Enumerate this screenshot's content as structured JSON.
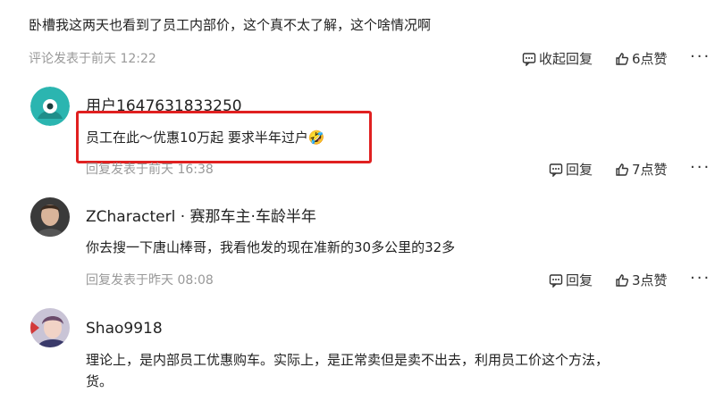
{
  "top_comment": {
    "text": "卧槽我这两天也看到了员工内部价，这个真不太了解，这个啥情况啊",
    "meta": "评论发表于前天 12:22",
    "collapse_label": "收起回复",
    "like_label": "6点赞",
    "more_label": "···"
  },
  "replies": [
    {
      "username": "用户1647631833250",
      "text": "员工在此～优惠10万起 要求半年过户🤣",
      "meta": "回复发表于前天 16:38",
      "reply_label": "回复",
      "like_label": "7点赞",
      "more_label": "···"
    },
    {
      "username": "ZCharacterl · 赛那车主·车龄半年",
      "text": "你去搜一下唐山棒哥，我看他发的现在准新的30多公里的32多",
      "meta": "回复发表于昨天 08:08",
      "reply_label": "回复",
      "like_label": "3点赞",
      "more_label": "···"
    },
    {
      "username": "Shao9918",
      "text": "理论上，是内部员工优惠购车。实际上，是正常卖但是卖不出去，利用员工价这个方法，",
      "text_line2": "货。"
    }
  ],
  "colors": {
    "highlight": "#e02020",
    "meta_text": "#999999",
    "avatar_teal": "#2bb5b0"
  },
  "icons": [
    "reply-icon",
    "thumbs-up-icon",
    "more-icon"
  ]
}
